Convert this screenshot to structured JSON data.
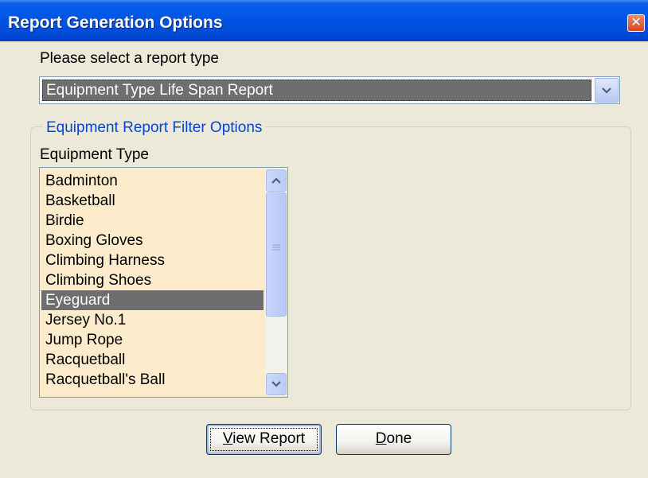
{
  "window": {
    "title": "Report Generation Options",
    "close_glyph": "✕"
  },
  "report_type": {
    "label": "Please select a report type",
    "selected_value": "Equipment Type Life Span Report",
    "arrow_icon": "chevron-down-icon"
  },
  "filter_group": {
    "legend": "Equipment Report Filter Options",
    "equipment_type_label": "Equipment Type",
    "items": [
      {
        "label": "Badminton",
        "selected": false
      },
      {
        "label": "Basketball",
        "selected": false
      },
      {
        "label": "Birdie",
        "selected": false
      },
      {
        "label": "Boxing Gloves",
        "selected": false
      },
      {
        "label": "Climbing Harness",
        "selected": false
      },
      {
        "label": "Climbing Shoes",
        "selected": false
      },
      {
        "label": "Eyeguard",
        "selected": true
      },
      {
        "label": "Jersey No.1",
        "selected": false
      },
      {
        "label": "Jump Rope",
        "selected": false
      },
      {
        "label": "Racquetball",
        "selected": false
      },
      {
        "label": "Racquetball's Ball",
        "selected": false
      }
    ]
  },
  "buttons": {
    "view_report": {
      "mnemonic": "V",
      "rest": "iew Report"
    },
    "done": {
      "mnemonic": "D",
      "rest": "one"
    }
  },
  "colors": {
    "title_bar": "#0055e5",
    "list_background": "#fdeccb",
    "selection": "#6e6e6e",
    "group_legend": "#0046d5"
  }
}
